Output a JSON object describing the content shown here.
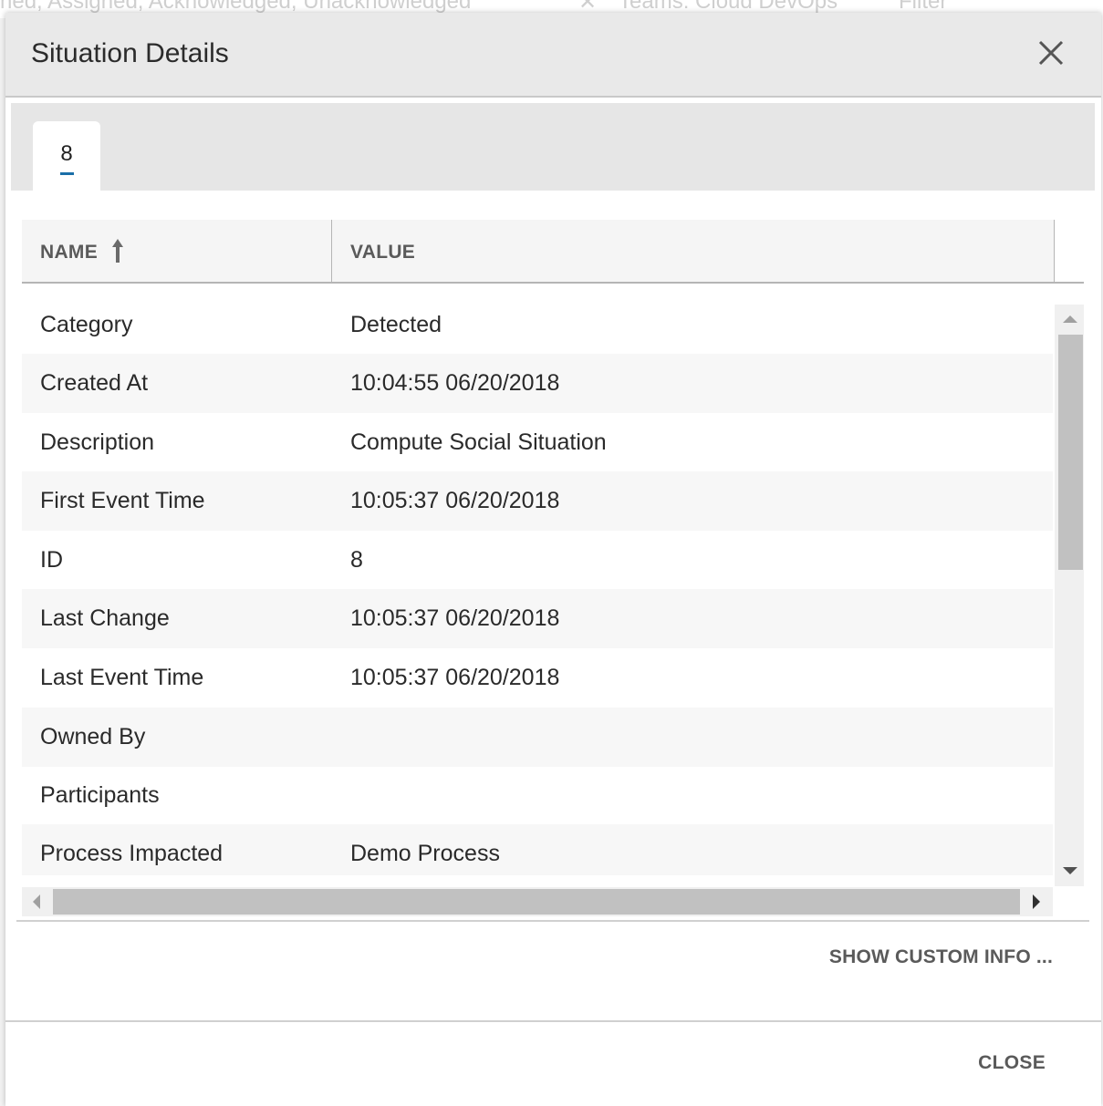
{
  "background": {
    "filter_chips": [
      "ned, Assigned, Acknowledged, Unacknowledged",
      "Teams: Cloud DevOps",
      "Filter"
    ]
  },
  "modal": {
    "title": "Situation Details",
    "close_icon": "close-icon"
  },
  "tabs": [
    {
      "label": "8",
      "active": true
    }
  ],
  "grid": {
    "columns": [
      {
        "label": "NAME",
        "sorted": "ascending"
      },
      {
        "label": "VALUE"
      }
    ],
    "rows": [
      {
        "name": "Category",
        "value": "Detected"
      },
      {
        "name": "Created At",
        "value": " 10:04:55 06/20/2018"
      },
      {
        "name": "Description",
        "value": "Compute Social Situation"
      },
      {
        "name": "First Event Time",
        "value": " 10:05:37 06/20/2018"
      },
      {
        "name": "ID",
        "value": "8"
      },
      {
        "name": "Last Change",
        "value": " 10:05:37 06/20/2018"
      },
      {
        "name": "Last Event Time",
        "value": " 10:05:37 06/20/2018"
      },
      {
        "name": "Owned By",
        "value": ""
      },
      {
        "name": "Participants",
        "value": ""
      },
      {
        "name": "Process Impacted",
        "value": "Demo Process"
      }
    ]
  },
  "actions": {
    "show_custom_info": "SHOW CUSTOM INFO ...",
    "close": "CLOSE"
  },
  "colors": {
    "accent": "#1a6fa8",
    "header_bg": "#e9e9e9",
    "row_alt": "#f7f7f7"
  }
}
